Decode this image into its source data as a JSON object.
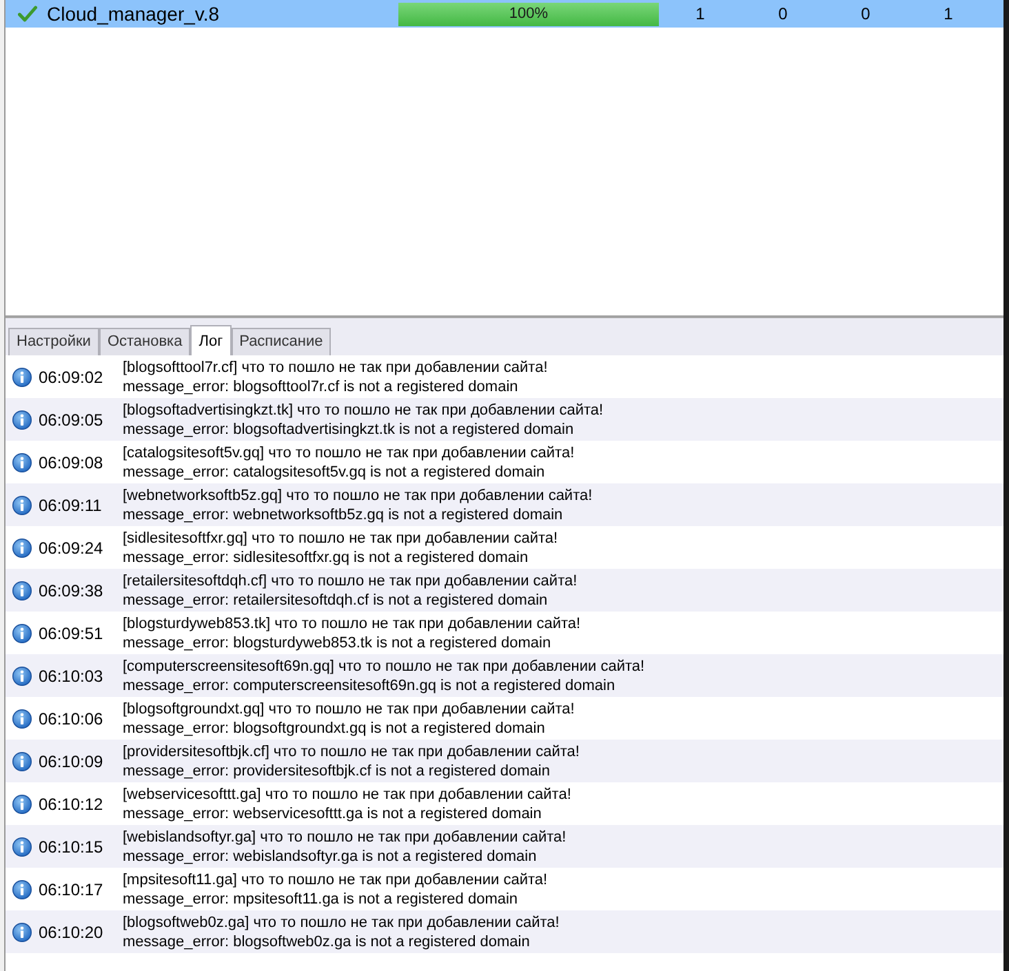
{
  "jobs": [
    {
      "done": true,
      "name": "Cloud_manager_v.8",
      "selected": true,
      "level": 1,
      "progress": "100%",
      "counts": [
        "1",
        "0",
        "0",
        "1"
      ]
    }
  ],
  "tabs": [
    {
      "label": "Настройки",
      "selected": false
    },
    {
      "label": "Остановка",
      "selected": false
    },
    {
      "label": "Лог",
      "selected": true
    },
    {
      "label": "Расписание",
      "selected": false
    }
  ],
  "log": [
    {
      "kind": "info",
      "time": "06:09:02",
      "title": "[blogsofttool7r.cf] что то пошло не так при добавлении сайта!",
      "message": "message_error: blogsofttool7r.cf is not a registered domain"
    },
    {
      "kind": "info",
      "time": "06:09:05",
      "title": "[blogsoftadvertisingkzt.tk] что то пошло не так при добавлении сайта!",
      "message": "message_error: blogsoftadvertisingkzt.tk is not a registered domain"
    },
    {
      "kind": "info",
      "time": "06:09:08",
      "title": "[catalogsitesoft5v.gq] что то пошло не так при добавлении сайта!",
      "message": "message_error: catalogsitesoft5v.gq is not a registered domain"
    },
    {
      "kind": "info",
      "time": "06:09:11",
      "title": "[webnetworksoftb5z.gq] что то пошло не так при добавлении сайта!",
      "message": "message_error: webnetworksoftb5z.gq is not a registered domain"
    },
    {
      "kind": "info",
      "time": "06:09:24",
      "title": "[sidlesitesoftfxr.gq] что то пошло не так при добавлении сайта!",
      "message": "message_error: sidlesitesoftfxr.gq is not a registered domain"
    },
    {
      "kind": "info",
      "time": "06:09:38",
      "title": "[retailersitesoftdqh.cf] что то пошло не так при добавлении сайта!",
      "message": "message_error: retailersitesoftdqh.cf is not a registered domain"
    },
    {
      "kind": "info",
      "time": "06:09:51",
      "title": "[blogsturdyweb853.tk] что то пошло не так при добавлении сайта!",
      "message": "message_error: blogsturdyweb853.tk is not a registered domain"
    },
    {
      "kind": "info",
      "time": "06:10:03",
      "title": "[computerscreensitesoft69n.gq] что то пошло не так при добавлении сайта!",
      "message": "message_error: computerscreensitesoft69n.gq is not a registered domain"
    },
    {
      "kind": "info",
      "time": "06:10:06",
      "title": "[blogsoftgroundxt.gq] что то пошло не так при добавлении сайта!",
      "message": "message_error: blogsoftgroundxt.gq is not a registered domain"
    },
    {
      "kind": "info",
      "time": "06:10:09",
      "title": "[providersitesoftbjk.cf] что то пошло не так при добавлении сайта!",
      "message": "message_error: providersitesoftbjk.cf is not a registered domain"
    },
    {
      "kind": "info",
      "time": "06:10:12",
      "title": "[webservicesofttt.ga] что то пошло не так при добавлении сайта!",
      "message": "message_error: webservicesofttt.ga is not a registered domain"
    },
    {
      "kind": "info",
      "time": "06:10:15",
      "title": "[webislandsoftyr.ga] что то пошло не так при добавлении сайта!",
      "message": "message_error: webislandsoftyr.ga is not a registered domain"
    },
    {
      "kind": "info",
      "time": "06:10:17",
      "title": "[mpsitesoft11.ga] что то пошло не так при добавлении сайта!",
      "message": "message_error: mpsitesoft11.ga is not a registered domain"
    },
    {
      "kind": "info",
      "time": "06:10:20",
      "title": "[blogsoftweb0z.ga] что то пошло не так при добавлении сайта!",
      "message": "message_error: blogsoftweb0z.ga is not a registered domain"
    }
  ]
}
